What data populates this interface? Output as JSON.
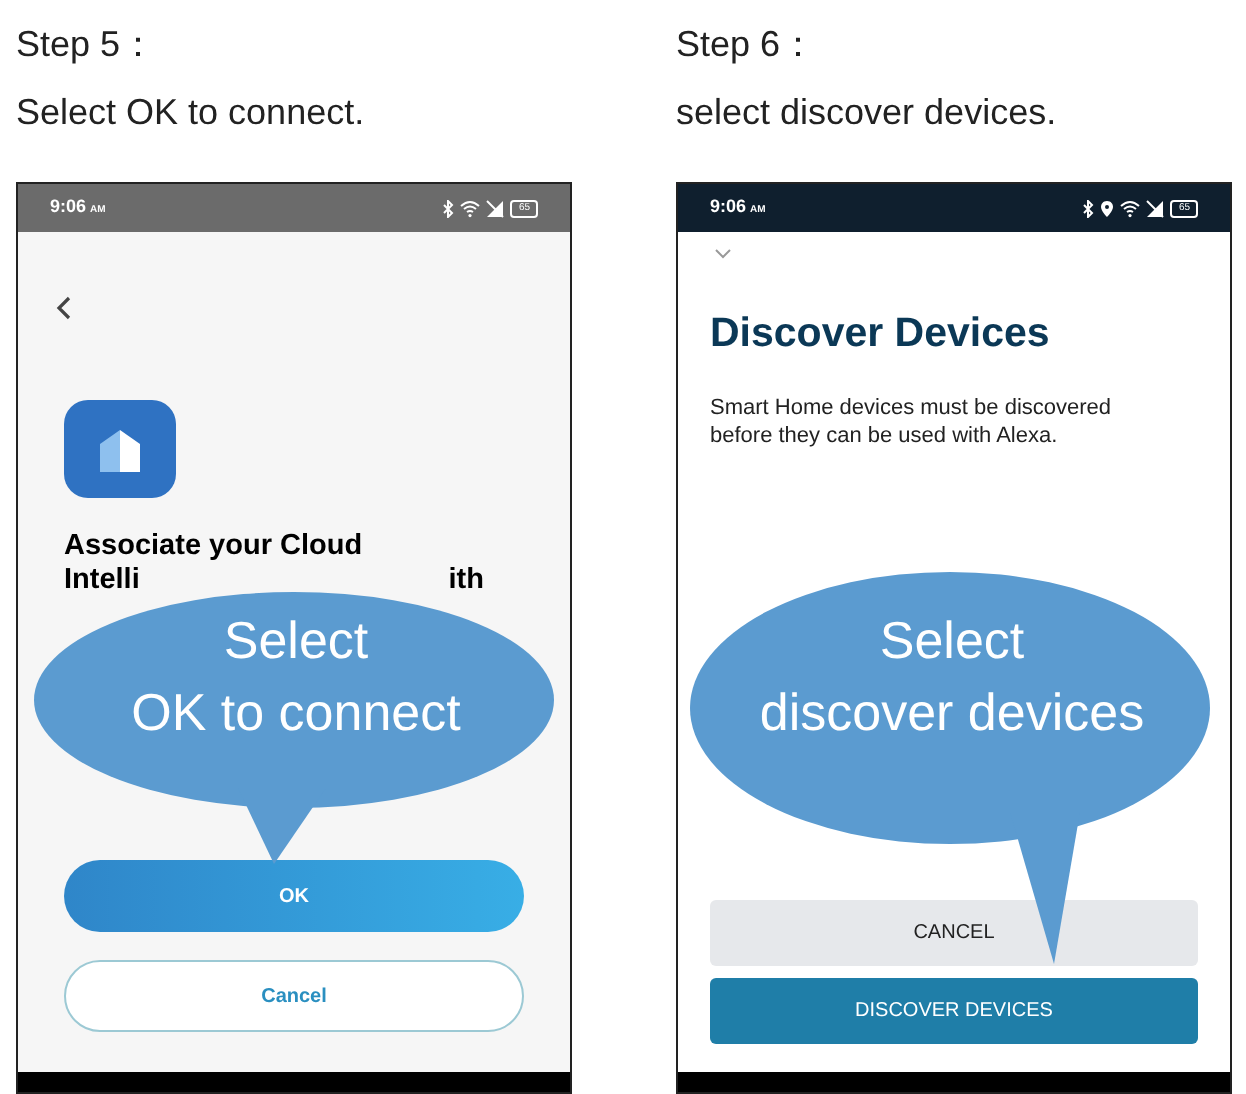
{
  "steps": [
    {
      "title": "Step 5：",
      "instruction": "Select OK to connect.",
      "phone": {
        "kind": "light",
        "time": "9:06",
        "ampm": "AM",
        "battery": "65",
        "location": false,
        "heading": "Associate your Cloud",
        "heading_fragments": [
          "Intelli",
          "ith"
        ],
        "buttons": [
          {
            "label": "OK",
            "kind": "primary"
          },
          {
            "label": "Cancel",
            "kind": "outline"
          }
        ]
      },
      "bubble": {
        "lines": [
          "Select",
          "OK to connect"
        ]
      }
    },
    {
      "title": "Step 6：",
      "instruction": "select discover devices.",
      "phone": {
        "kind": "dark",
        "time": "9:06",
        "ampm": "AM",
        "battery": "65",
        "location": true,
        "title": "Discover Devices",
        "description": "Smart Home devices must be discovered before they can be used with Alexa.",
        "buttons": [
          {
            "label": "CANCEL",
            "kind": "flat"
          },
          {
            "label": "DISCOVER DEVICES",
            "kind": "solid"
          }
        ]
      },
      "bubble": {
        "lines": [
          "Select",
          "discover devices"
        ]
      }
    }
  ]
}
